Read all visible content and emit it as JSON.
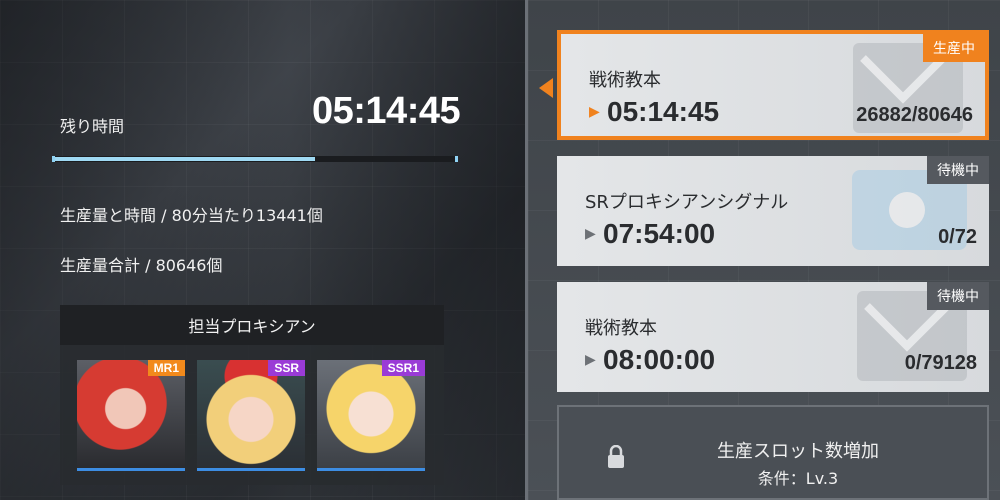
{
  "left": {
    "remaining_label": "残り時間",
    "remaining_time": "05:14:45",
    "progress_fraction": 0.65,
    "production_rate": "生産量と時間 / 80分当たり13441個",
    "production_total": "生産量合計 / 80646個",
    "assign_header": "担当プロキシアン",
    "portraits": [
      {
        "rank": "MR1"
      },
      {
        "rank": "SSR"
      },
      {
        "rank": "SSR1"
      }
    ]
  },
  "cards": [
    {
      "title": "戦術教本",
      "time": "05:14:45",
      "count": "26882/80646",
      "status": "生産中",
      "status_color": "#f0821e",
      "selected": true
    },
    {
      "title": "SRプロキシアンシグナル",
      "time": "07:54:00",
      "count": "0/72",
      "status": "待機中",
      "status_color": "#55595f",
      "selected": false
    },
    {
      "title": "戦術教本",
      "time": "08:00:00",
      "count": "0/79128",
      "status": "待機中",
      "status_color": "#55595f",
      "selected": false
    }
  ],
  "slot": {
    "title": "生産スロット数増加",
    "condition": "条件：Lv.3"
  },
  "colors": {
    "accent_orange": "#f0821e",
    "progress_blue": "#9fd9f3",
    "rank_mr": "#f28a1c",
    "rank_ssr": "#9a3bd6"
  },
  "icons": {
    "play": "play-arrow-icon",
    "lock": "lock-icon"
  }
}
